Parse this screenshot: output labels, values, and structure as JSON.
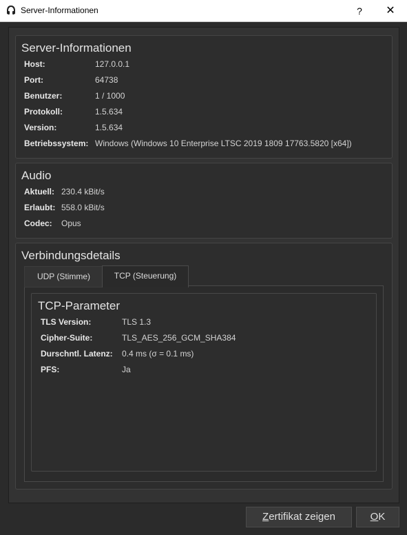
{
  "window": {
    "title": "Server-Informationen",
    "help": "?",
    "close": "✕"
  },
  "server": {
    "title": "Server-Informationen",
    "rows": [
      {
        "label": "Host:",
        "value": "127.0.0.1"
      },
      {
        "label": "Port:",
        "value": "64738"
      },
      {
        "label": "Benutzer:",
        "value": "1 / 1000"
      },
      {
        "label": "Protokoll:",
        "value": "1.5.634"
      },
      {
        "label": "Version:",
        "value": "1.5.634"
      },
      {
        "label": "Betriebssystem:",
        "value": "Windows (Windows 10 Enterprise LTSC 2019 1809 17763.5820 [x64])"
      }
    ]
  },
  "audio": {
    "title": "Audio",
    "rows": [
      {
        "label": "Aktuell:",
        "value": "230.4 kBit/s"
      },
      {
        "label": "Erlaubt:",
        "value": "558.0 kBit/s"
      },
      {
        "label": "Codec:",
        "value": "Opus"
      }
    ]
  },
  "connection": {
    "title": "Verbindungsdetails",
    "tabs": [
      {
        "label": "UDP (Stimme)",
        "active": false
      },
      {
        "label": "TCP (Steuerung)",
        "active": true
      }
    ],
    "tcp": {
      "title": "TCP-Parameter",
      "rows": [
        {
          "label": "TLS Version:",
          "value": "TLS 1.3"
        },
        {
          "label": "Cipher-Suite:",
          "value": "TLS_AES_256_GCM_SHA384"
        },
        {
          "label": "Durschntl. Latenz:",
          "value": "0.4 ms (σ = 0.1 ms)"
        },
        {
          "label": "PFS:",
          "value": "Ja"
        }
      ]
    }
  },
  "buttons": {
    "certificate_mnemonic": "Z",
    "certificate_rest": "ertifikat zeigen",
    "ok_mnemonic": "O",
    "ok_rest": "K"
  }
}
